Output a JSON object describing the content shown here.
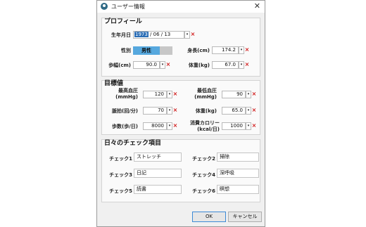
{
  "window": {
    "title": "ユーザー情報"
  },
  "profile": {
    "heading": "プロフィール",
    "birthdate": {
      "label": "生年月日",
      "year": "1973",
      "rest": " / 06 / 13"
    },
    "gender": {
      "label": "性別",
      "value": "男性"
    },
    "height": {
      "label": "身長(cm)",
      "value": "174.2"
    },
    "stride": {
      "label": "歩幅(cm)",
      "value": "90.0"
    },
    "weight": {
      "label": "体重(kg)",
      "value": "67.0"
    }
  },
  "targets": {
    "heading": "目標値",
    "systolic": {
      "label1": "最高血圧",
      "label2": "(mmHg)",
      "value": "120"
    },
    "diastolic": {
      "label1": "最低血圧",
      "label2": "(mmHg)",
      "value": "90"
    },
    "pulse": {
      "label": "脈拍(回/分)",
      "value": "70"
    },
    "weight": {
      "label": "体重(kg)",
      "value": "65.0"
    },
    "steps": {
      "label": "歩数(歩/日)",
      "value": "8000"
    },
    "calories": {
      "label1": "消費カロリー",
      "label2": "(kcal/日)",
      "value": "1000"
    }
  },
  "checks": {
    "heading": "日々のチェック項目",
    "items": [
      {
        "label": "チェック1",
        "value": "ストレッチ"
      },
      {
        "label": "チェック2",
        "value": "掃除"
      },
      {
        "label": "チェック3",
        "value": "日記"
      },
      {
        "label": "チェック4",
        "value": "深呼吸"
      },
      {
        "label": "チェック5",
        "value": "読書"
      },
      {
        "label": "チェック6",
        "value": "瞑想"
      }
    ]
  },
  "buttons": {
    "ok": "OK",
    "cancel": "キャンセル"
  },
  "icons": {
    "dropdown": "▾",
    "clear": "×",
    "close": "✕"
  },
  "colors": {
    "selection": "#2a6db5",
    "toggle_on": "#56a8de",
    "clear_icon": "#d01818"
  }
}
